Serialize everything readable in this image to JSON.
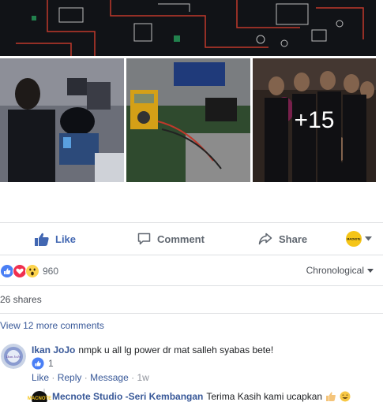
{
  "photos": {
    "more_count": "+15"
  },
  "actions": {
    "like_label": "Like",
    "comment_label": "Comment",
    "share_label": "Share",
    "page_avatar_text": "MACNOTE"
  },
  "reactions": {
    "count": "960",
    "icons": [
      "like-reaction-icon",
      "love-reaction-icon",
      "wow-reaction-icon"
    ],
    "sort_label": "Chronological"
  },
  "shares_label": "26 shares",
  "view_more_label": "View 12 more comments",
  "comment": {
    "avatar_text": "Ikan JoJo",
    "author": "Ikan JoJo",
    "text": "nmpk u all lg power dr mat salleh syabas bete!",
    "like_count": "1",
    "like_link": "Like",
    "reply_link": "Reply",
    "message_link": "Message",
    "time": "1w",
    "separator": "·"
  },
  "reply": {
    "avatar_text": "MACNOTE",
    "author": "Mecnote Studio -Seri Kembangan",
    "text": "Terima Kasih kami ucapkan"
  },
  "colors": {
    "link": "#385898",
    "like_blue": "#4267b2",
    "muted": "#606770"
  }
}
